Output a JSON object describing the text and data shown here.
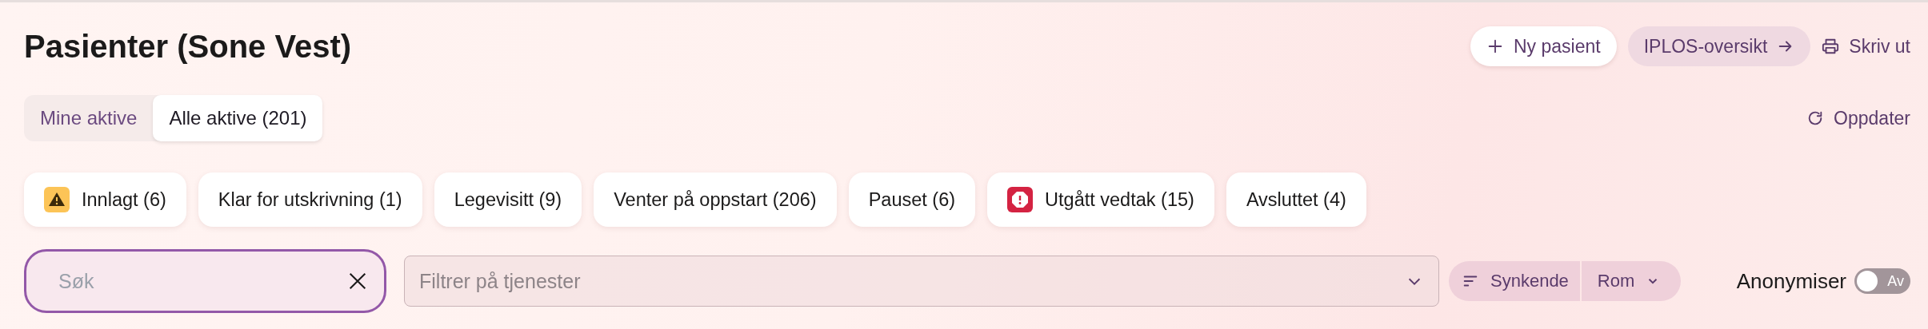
{
  "title": "Pasienter (Sone Vest)",
  "actions": [
    {
      "kind": "add",
      "label": "Ny pasient"
    },
    {
      "kind": "link",
      "label": "IPLOS-oversikt"
    },
    {
      "kind": "print",
      "label": "Skriv ut"
    }
  ],
  "tabs": [
    {
      "label": "Mine aktive",
      "selected": false
    },
    {
      "label": "Alle aktive (201)",
      "selected": true
    }
  ],
  "refresh": {
    "label": "Oppdater"
  },
  "status_chips": [
    {
      "label": "Innlagt (6)",
      "kind": "warning"
    },
    {
      "label": "Klar for utskrivning (1)",
      "kind": "plain"
    },
    {
      "label": "Legevisitt (9)",
      "kind": "plain"
    },
    {
      "label": "Venter på oppstart (206)",
      "kind": "plain"
    },
    {
      "label": "Pauset (6)",
      "kind": "plain"
    },
    {
      "label": "Utgått vedtak (15)",
      "kind": "alert"
    },
    {
      "label": "Avsluttet (4)",
      "kind": "plain"
    }
  ],
  "search": {
    "placeholder": "Søk"
  },
  "service_filter": {
    "placeholder": "Filtrer på tjenester"
  },
  "sort": {
    "direction": "Synkende",
    "field": "Rom"
  },
  "anonymize": {
    "label": "Anonymiser",
    "on": false,
    "state_label": "Av"
  }
}
